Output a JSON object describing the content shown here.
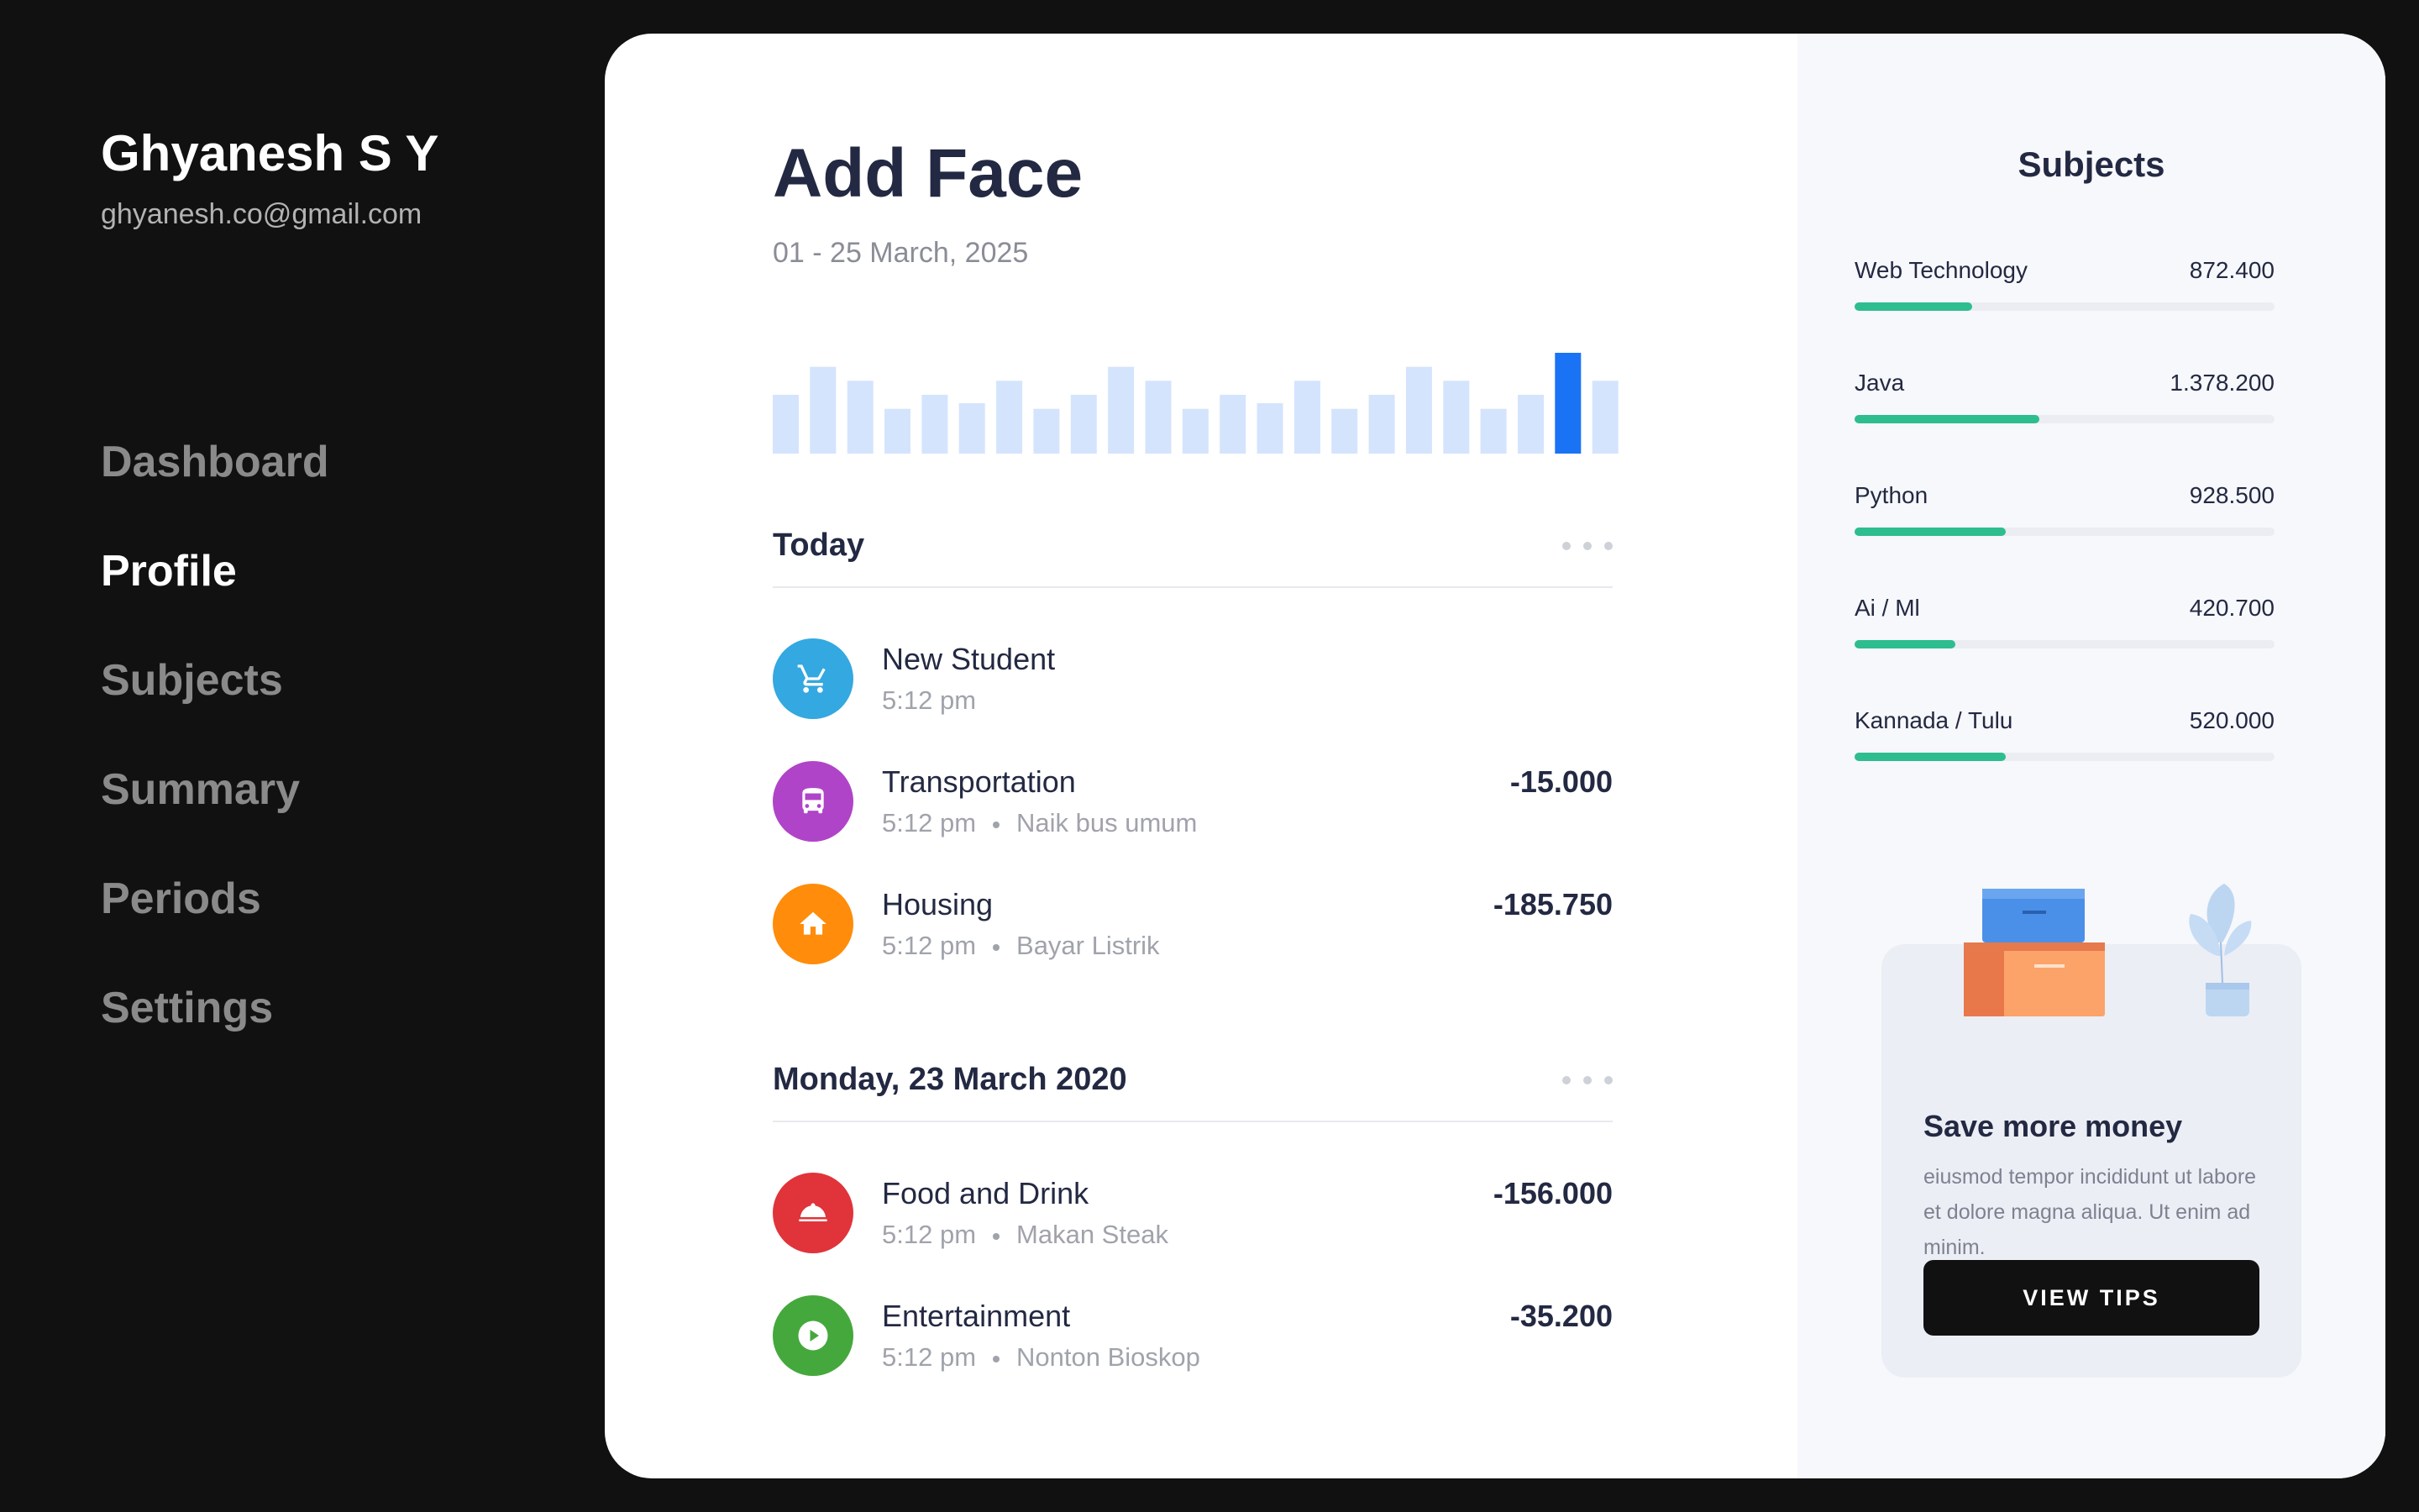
{
  "user": {
    "name": "Ghyanesh S Y",
    "email": "ghyanesh.co@gmail.com"
  },
  "nav": {
    "items": [
      {
        "label": "Dashboard",
        "active": false
      },
      {
        "label": "Profile",
        "active": true
      },
      {
        "label": "Subjects",
        "active": false
      },
      {
        "label": "Summary",
        "active": false
      },
      {
        "label": "Periods",
        "active": false
      },
      {
        "label": "Settings",
        "active": false
      }
    ]
  },
  "main": {
    "title": "Add Face",
    "date_range": "01 - 25 March, 2025"
  },
  "chart_data": {
    "type": "bar",
    "values": [
      42,
      62,
      52,
      32,
      42,
      36,
      52,
      32,
      42,
      62,
      52,
      32,
      42,
      36,
      52,
      32,
      42,
      62,
      52,
      32,
      42,
      72,
      52
    ],
    "highlight_index": 21,
    "colors": {
      "bar": "#d4e4fd",
      "highlight": "#1a73f5"
    }
  },
  "sections": [
    {
      "title": "Today",
      "transactions": [
        {
          "title": "New Student",
          "time": "5:12 pm",
          "note": "",
          "amount": "",
          "icon": "cart-icon",
          "color": "#34a8e0"
        },
        {
          "title": "Transportation",
          "time": "5:12 pm",
          "note": "Naik bus umum",
          "amount": "-15.000",
          "icon": "bus-icon",
          "color": "#b044c8"
        },
        {
          "title": "Housing",
          "time": "5:12 pm",
          "note": "Bayar Listrik",
          "amount": "-185.750",
          "icon": "home-icon",
          "color": "#ff8c0a"
        }
      ]
    },
    {
      "title": "Monday, 23 March 2020",
      "transactions": [
        {
          "title": "Food and Drink",
          "time": "5:12 pm",
          "note": "Makan Steak",
          "amount": "-156.000",
          "icon": "food-cloche-icon",
          "color": "#e0343a"
        },
        {
          "title": "Entertainment",
          "time": "5:12 pm",
          "note": "Nonton Bioskop",
          "amount": "-35.200",
          "icon": "play-icon",
          "color": "#45a83c"
        }
      ]
    }
  ],
  "subjects": {
    "title": "Subjects",
    "items": [
      {
        "name": "Web Technology",
        "value": "872.400",
        "progress": 0.28
      },
      {
        "name": "Java",
        "value": "1.378.200",
        "progress": 0.44
      },
      {
        "name": "Python",
        "value": "928.500",
        "progress": 0.36
      },
      {
        "name": "Ai / Ml",
        "value": "420.700",
        "progress": 0.24
      },
      {
        "name": "Kannada / Tulu",
        "value": "520.000",
        "progress": 0.36
      }
    ]
  },
  "tips": {
    "title": "Save more money",
    "text": "eiusmod tempor incididunt ut labore et dolore magna aliqua. Ut enim ad minim.",
    "button": "VIEW TIPS"
  }
}
